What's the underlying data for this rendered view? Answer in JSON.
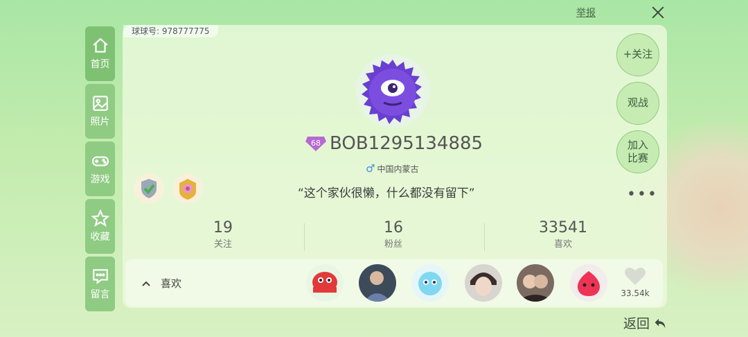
{
  "header": {
    "report": "举报",
    "close_icon": "close-icon"
  },
  "profile": {
    "qiuqiu_id": "球球号: 978777775",
    "level": "68",
    "username": "BOB1295134885",
    "gender_symbol": "♂",
    "location": "中国内蒙古",
    "signature": "“这个家伙很懒，什么都没有留下”"
  },
  "sidebar": {
    "items": [
      {
        "label": "首页",
        "icon": "home-icon",
        "active": true
      },
      {
        "label": "照片",
        "icon": "photo-icon"
      },
      {
        "label": "游戏",
        "icon": "gamepad-icon"
      },
      {
        "label": "收藏",
        "icon": "star-icon"
      },
      {
        "label": "留言",
        "icon": "message-icon"
      }
    ]
  },
  "actions": {
    "follow": "+关注",
    "watch": "观战",
    "join_1": "加入",
    "join_2": "比赛",
    "more": "•••"
  },
  "stats": [
    {
      "value": "19",
      "label": "关注"
    },
    {
      "value": "16",
      "label": "粉丝"
    },
    {
      "value": "33541",
      "label": "喜欢"
    }
  ],
  "likes_row": {
    "label": "喜欢",
    "count": "33.54k"
  },
  "footer": {
    "back": "返回"
  },
  "colors": {
    "accent": "#7fc173",
    "avatar_purple": "#6a3fd0"
  }
}
